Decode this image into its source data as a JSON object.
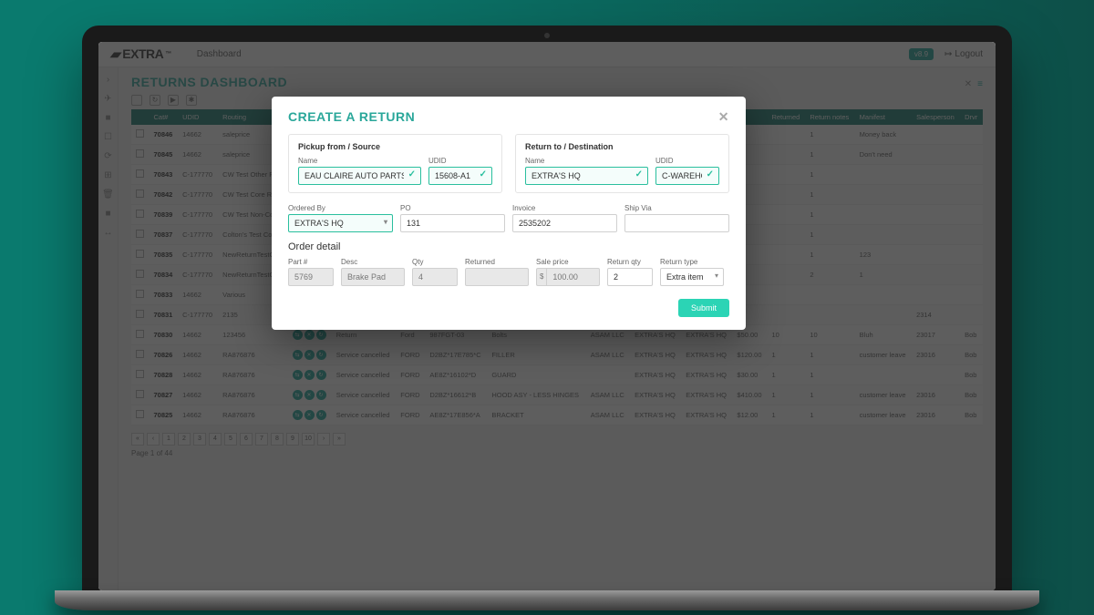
{
  "app": {
    "brand": "EXTRA",
    "nav": [
      "Dashboard"
    ],
    "version_badge": "v8.9",
    "logout": "Logout"
  },
  "page": {
    "title": "RETURNS DASHBOARD",
    "page_info": "Page 1 of 44"
  },
  "table": {
    "headers": [
      "",
      "Cat#",
      "UDID",
      "Routing",
      "",
      "",
      "",
      "",
      "",
      "",
      "",
      "",
      "",
      "Returned",
      "Return notes",
      "Manifest",
      "Salesperson",
      "Drvr"
    ],
    "rows": [
      {
        "cat": "70846",
        "udid": "14662",
        "routing": "saleprice",
        "ret": "1",
        "notes": "Money back"
      },
      {
        "cat": "70845",
        "udid": "14662",
        "routing": "saleprice",
        "ret": "1",
        "notes": "Don't need"
      },
      {
        "cat": "70843",
        "udid": "C-177770",
        "routing": "CW Test Other Ret",
        "ret": "1"
      },
      {
        "cat": "70842",
        "udid": "C-177770",
        "routing": "CW Test Core Retu",
        "ret": "1"
      },
      {
        "cat": "70839",
        "udid": "C-177770",
        "routing": "CW Test Non-Core",
        "ret": "1"
      },
      {
        "cat": "70837",
        "udid": "C-177770",
        "routing": "Colton's Test Core",
        "ret": "1"
      },
      {
        "cat": "70835",
        "udid": "C-177770",
        "routing": "NewReturnTestCW",
        "ret": "1",
        "notes": "123"
      },
      {
        "cat": "70834",
        "udid": "C-177770",
        "routing": "NewReturnTestCW",
        "ret": "2",
        "notes": "1"
      },
      {
        "cat": "70833",
        "udid": "14662",
        "routing": "Various"
      },
      {
        "cat": "70831",
        "udid": "C-177770",
        "routing": "2135",
        "misc": "2314"
      },
      {
        "cat": "70830",
        "udid": "14662",
        "routing": "123456",
        "act": true,
        "status": "Return",
        "make": "Ford",
        "part": "987FGT-03",
        "desc": "Bolts",
        "cust": "ASAM LLC",
        "src": "EXTRA'S HQ",
        "dst": "EXTRA'S HQ",
        "price": "$50.00",
        "qty": "10",
        "ret": "10",
        "notes": "Bluh",
        "man": "23017",
        "drvr": "Bob"
      },
      {
        "cat": "70826",
        "udid": "14662",
        "routing": "RA876876",
        "act": true,
        "status": "Service cancelled",
        "make": "FORD",
        "part": "D2BZ*17E785*C",
        "desc": "FILLER",
        "cust": "ASAM LLC",
        "src": "EXTRA'S HQ",
        "dst": "EXTRA'S HQ",
        "price": "$120.00",
        "qty": "1",
        "ret": "1",
        "notes": "customer leave",
        "man": "23016",
        "drvr": "Bob"
      },
      {
        "cat": "70828",
        "udid": "14662",
        "routing": "RA876876",
        "act": true,
        "status": "Service cancelled",
        "make": "FORD",
        "part": "AE8Z*16102*D",
        "desc": "GUARD",
        "cust": "",
        "src": "EXTRA'S HQ",
        "dst": "EXTRA'S HQ",
        "price": "$30.00",
        "qty": "1",
        "ret": "1",
        "notes": "",
        "man": "",
        "drvr": "Bob"
      },
      {
        "cat": "70827",
        "udid": "14662",
        "routing": "RA876876",
        "act": true,
        "status": "Service cancelled",
        "make": "FORD",
        "part": "D2BZ*16612*B",
        "desc": "HOOD ASY - LESS HINGES",
        "cust": "ASAM LLC",
        "src": "EXTRA'S HQ",
        "dst": "EXTRA'S HQ",
        "price": "$410.00",
        "qty": "1",
        "ret": "1",
        "notes": "customer leave",
        "man": "23016",
        "drvr": "Bob"
      },
      {
        "cat": "70825",
        "udid": "14662",
        "routing": "RA876876",
        "act": true,
        "status": "Service cancelled",
        "make": "FORD",
        "part": "AE8Z*17E856*A",
        "desc": "BRACKET",
        "cust": "ASAM LLC",
        "src": "EXTRA'S HQ",
        "dst": "EXTRA'S HQ",
        "price": "$12.00",
        "qty": "1",
        "ret": "1",
        "notes": "customer leave",
        "man": "23016",
        "drvr": "Bob"
      }
    ],
    "pager": [
      "«",
      "‹",
      "1",
      "2",
      "3",
      "4",
      "5",
      "6",
      "7",
      "8",
      "9",
      "10",
      "›",
      "»"
    ]
  },
  "modal": {
    "title": "CREATE A RETURN",
    "source": {
      "header": "Pickup from / Source",
      "name_label": "Name",
      "name_value": "EAU CLAIRE AUTO PARTS INC",
      "udid_label": "UDID",
      "udid_value": "15608-A1"
    },
    "dest": {
      "header": "Return to / Destination",
      "name_label": "Name",
      "name_value": "EXTRA'S HQ",
      "udid_label": "UDID",
      "udid_value": "C-WAREHOUSE"
    },
    "ordered_by": {
      "label": "Ordered By",
      "value": "EXTRA'S HQ"
    },
    "po": {
      "label": "PO",
      "value": "131"
    },
    "invoice": {
      "label": "Invoice",
      "value": "2535202"
    },
    "ship_via": {
      "label": "Ship Via",
      "value": ""
    },
    "detail_header": "Order detail",
    "detail": {
      "part": {
        "label": "Part #",
        "value": "5769"
      },
      "desc": {
        "label": "Desc",
        "value": "Brake Pad"
      },
      "qty": {
        "label": "Qty",
        "value": "4"
      },
      "returned": {
        "label": "Returned",
        "value": ""
      },
      "sale": {
        "label": "Sale price",
        "currency": "$",
        "value": "100.00"
      },
      "retqty": {
        "label": "Return qty",
        "value": "2"
      },
      "rettype": {
        "label": "Return type",
        "value": "Extra item"
      }
    },
    "submit": "Submit"
  }
}
